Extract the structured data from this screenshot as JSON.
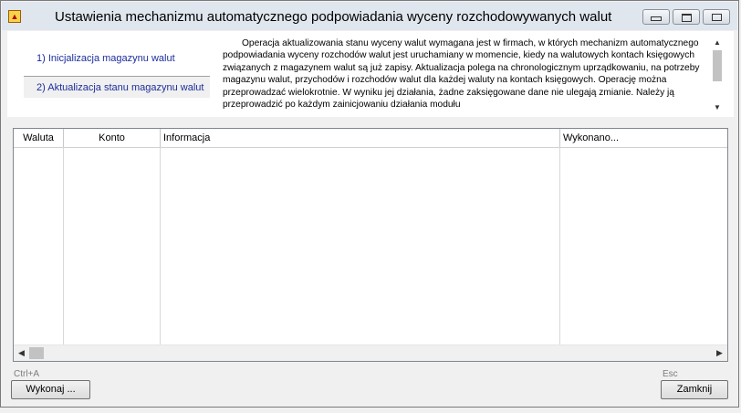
{
  "window": {
    "title": "Ustawienia mechanizmu automatycznego podpowiadania wyceny rozchodowywanych walut"
  },
  "steps": [
    {
      "label": "1) Inicjalizacja magazynu walut",
      "selected": false
    },
    {
      "label": "2) Aktualizacja stanu magazynu walut",
      "selected": true
    }
  ],
  "description": "Operacja aktualizowania stanu wyceny walut wymagana jest w firmach, w których mechanizm automatycznego podpowiadania wyceny rozchodów walut jest uruchamiany w momencie, kiedy na walutowych kontach księgowych związanych z magazynem walut są już zapisy. Aktualizacja polega na chronologicznym uprządkowaniu, na potrzeby magazynu walut, przychodów i rozchodów walut dla każdej waluty na kontach księgowych. Operację można przeprowadzać wielokrotnie. W wyniku jej działania, żadne zaksięgowane dane nie ulegają zmianie. Należy ją przeprowadzić po każdym zainicjowaniu działania modułu",
  "table": {
    "columns": [
      "Waluta",
      "Konto",
      "Informacja",
      "Wykonano..."
    ],
    "rows": []
  },
  "shortcuts": {
    "execute": "Ctrl+A",
    "close": "Esc"
  },
  "buttons": {
    "execute": "Wykonaj ...",
    "close": "Zamknij"
  },
  "colors": {
    "step_link": "#1c2d9c",
    "titlebar": "#dfe6ee",
    "background": "#f0f0f0"
  }
}
